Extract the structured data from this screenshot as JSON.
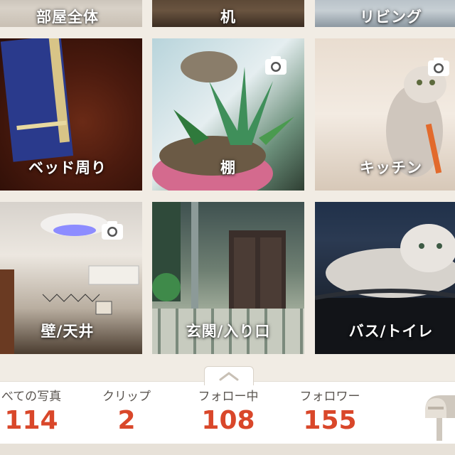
{
  "grid": {
    "tiles": [
      {
        "label": "部屋全体",
        "has_camera": false
      },
      {
        "label": "机",
        "has_camera": false
      },
      {
        "label": "リビング",
        "has_camera": false
      },
      {
        "label": "ベッド周り",
        "has_camera": false
      },
      {
        "label": "棚",
        "has_camera": true
      },
      {
        "label": "キッチン",
        "has_camera": true
      },
      {
        "label": "壁/天井",
        "has_camera": true
      },
      {
        "label": "玄関/入り口",
        "has_camera": false
      },
      {
        "label": "バス/トイレ",
        "has_camera": false
      }
    ],
    "camera_icon": "camera-icon"
  },
  "stats": {
    "all_photos": {
      "label": "べての写真",
      "value": "114"
    },
    "clips": {
      "label": "クリップ",
      "value": "2"
    },
    "following": {
      "label": "フォロー中",
      "value": "108"
    },
    "followers": {
      "label": "フォロワー",
      "value": "155"
    }
  },
  "icons": {
    "pull_tab": "chevron-up-icon",
    "mailbox": "mailbox-icon"
  },
  "colors": {
    "stat_value": "#d9472a",
    "background": "#f1ece4"
  }
}
